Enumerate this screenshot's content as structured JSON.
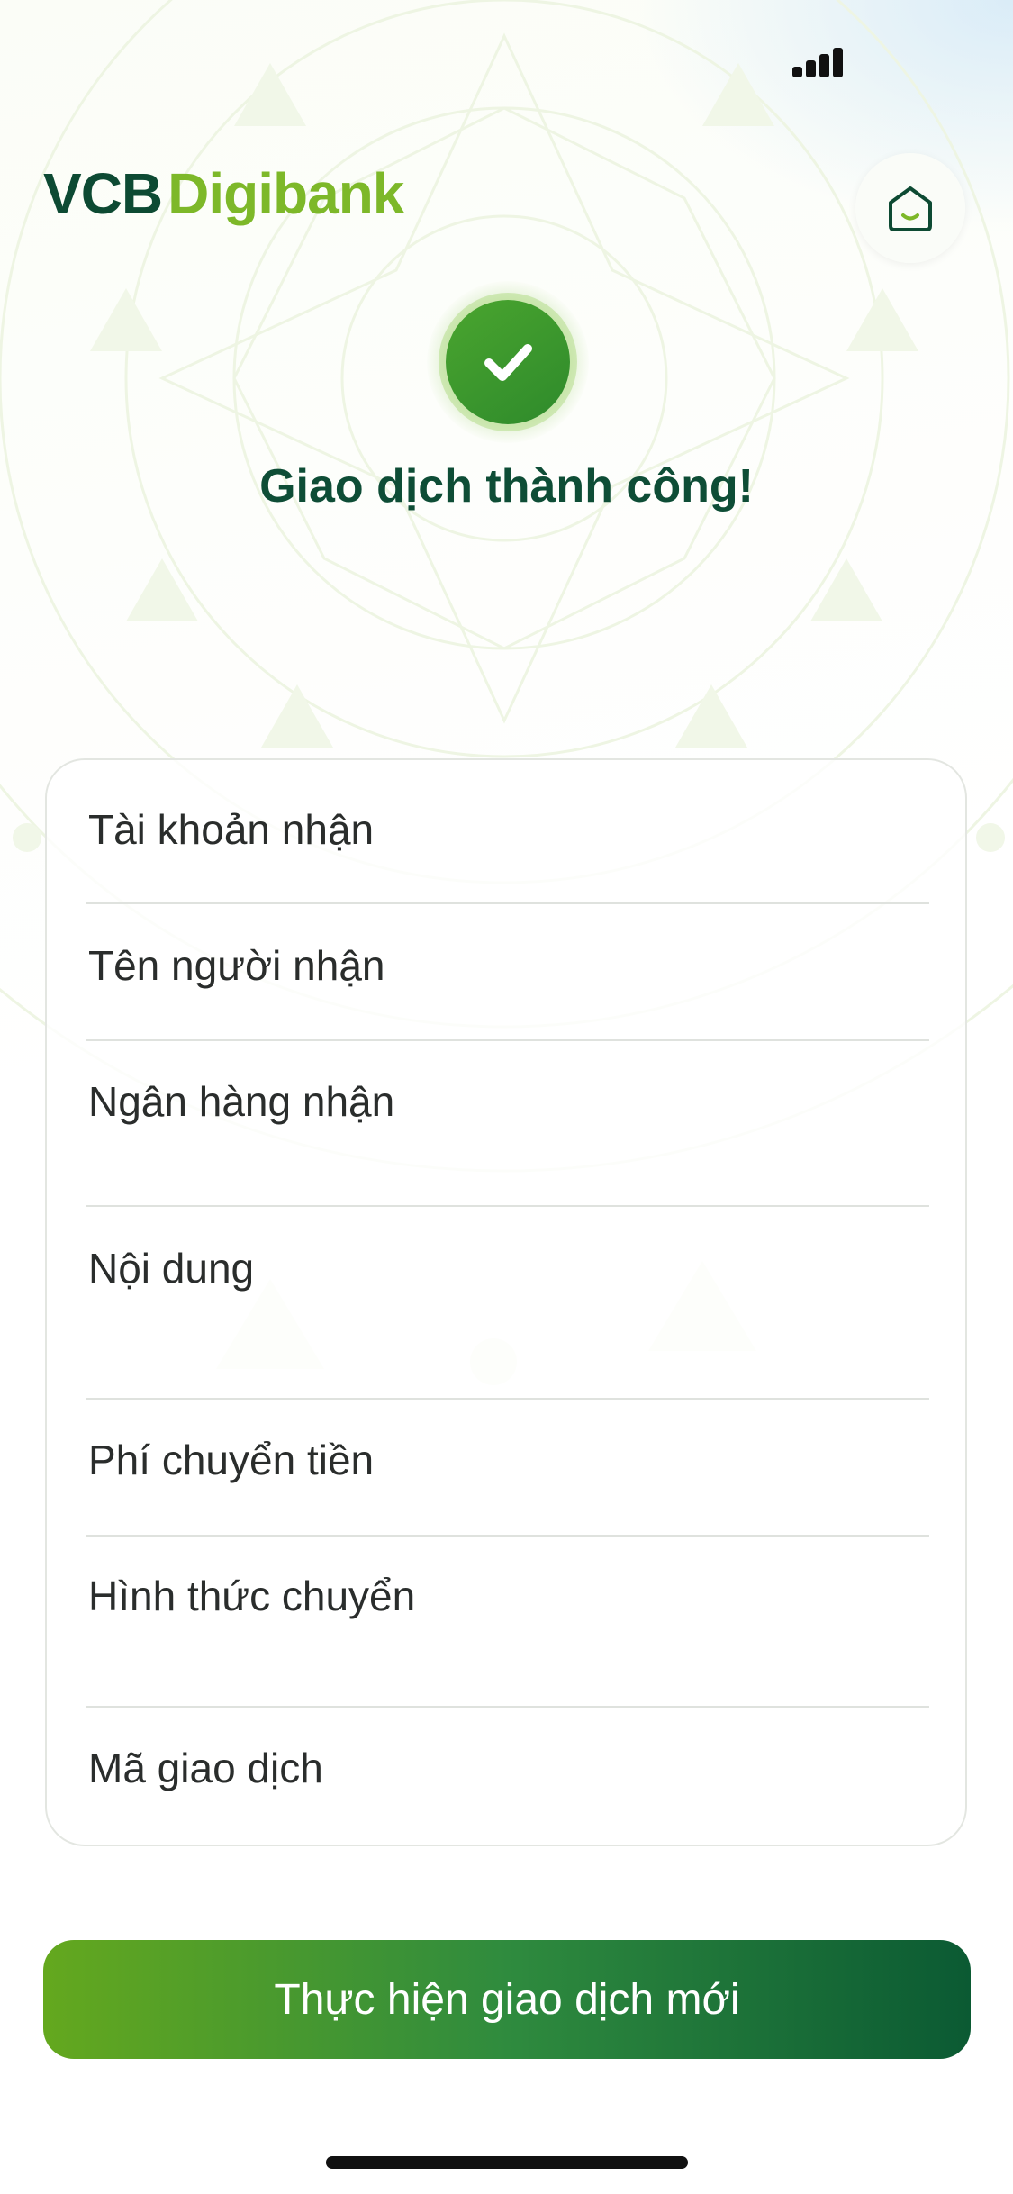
{
  "status_bar": {
    "signal_icon": "cellular-signal-icon"
  },
  "header": {
    "logo_primary": "VCB",
    "logo_secondary": "Digibank",
    "home_icon": "home-icon"
  },
  "result": {
    "icon": "check-circle-icon",
    "title": "Giao dịch thành công!"
  },
  "details": {
    "rows": [
      {
        "label": "Tài khoản nhận"
      },
      {
        "label": "Tên người nhận"
      },
      {
        "label": "Ngân hàng nhận"
      },
      {
        "label": "Nội dung"
      },
      {
        "label": "Phí chuyển tiền"
      },
      {
        "label": "Hình thức chuyển"
      },
      {
        "label": "Mã giao dịch"
      }
    ]
  },
  "actions": {
    "new_transaction_label": "Thực hiện giao dịch mới"
  },
  "colors": {
    "brand_dark": "#0d4a33",
    "brand_light": "#7db829",
    "success_green": "#3c9a2d"
  }
}
